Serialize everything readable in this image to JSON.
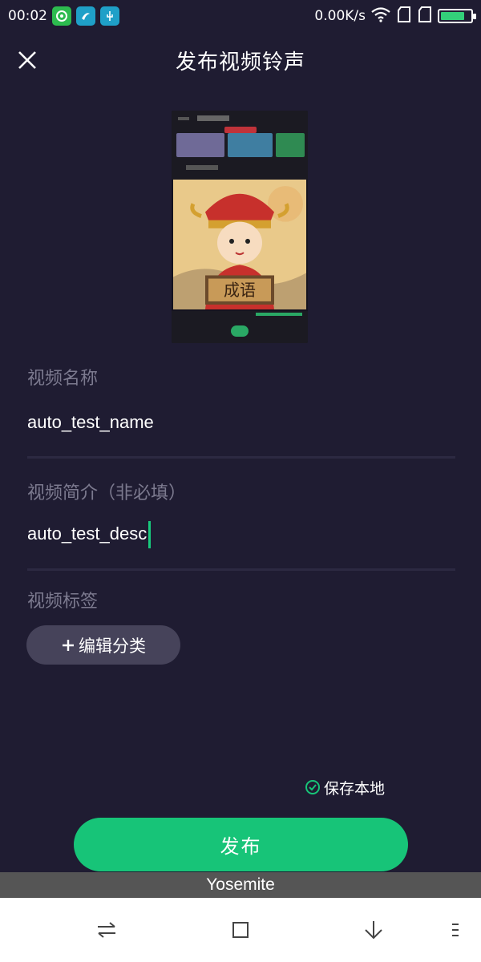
{
  "status_bar": {
    "time": "00:02",
    "network_speed": "0.00K/s",
    "battery_level": 0.8,
    "icons": [
      "wechat-icon",
      "app-icon",
      "usb-icon",
      "wifi-icon",
      "sim-icon",
      "sim-icon",
      "battery-icon"
    ]
  },
  "header": {
    "title": "发布视频铃声",
    "close_icon": "close-icon"
  },
  "thumbnail": {
    "artwork_text": "成语"
  },
  "form": {
    "name_label": "视频名称",
    "name_value": "auto_test_name",
    "desc_label": "视频简介（非必填）",
    "desc_value": "auto_test_desc",
    "tags_label": "视频标签",
    "edit_tags_button": "编辑分类",
    "edit_tags_icon": "plus-icon"
  },
  "save_local": {
    "label": "保存本地",
    "checked": true
  },
  "publish_button": "发布",
  "toast": "Yosemite",
  "nav": {
    "icons": [
      "switch-icon",
      "square-icon",
      "down-arrow-icon",
      "menu-icon"
    ]
  },
  "colors": {
    "background": "#1f1c32",
    "accent": "#17c478",
    "label": "#7c7a8f",
    "tag_button": "#46435a"
  }
}
